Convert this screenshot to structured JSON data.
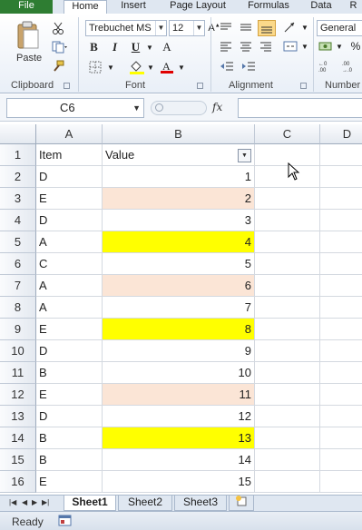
{
  "ribbon": {
    "tabs": [
      "File",
      "Home",
      "Insert",
      "Page Layout",
      "Formulas",
      "Data",
      "R"
    ],
    "active_tab": "Home",
    "groups": {
      "clipboard": "Clipboard",
      "font": "Font",
      "alignment": "Alignment",
      "number": "Number"
    },
    "clipboard": {
      "paste_label": "Paste"
    },
    "font": {
      "name": "Trebuchet MS",
      "size": "12",
      "bold": "B",
      "italic": "I",
      "underline": "U"
    },
    "number": {
      "format": "General",
      "percent": "%"
    },
    "colors": {
      "file_tab": "#2e7d32",
      "highlight_yellow": "#ffff00",
      "highlight_peach": "#fbe5d6",
      "font_color_bar": "#e00000",
      "fill_color_bar": "#ffff00"
    }
  },
  "formula_bar": {
    "name_box": "C6",
    "fx_label": "fx",
    "formula": ""
  },
  "grid": {
    "columns": [
      "A",
      "B",
      "C",
      "D"
    ],
    "header_row": {
      "row": "1",
      "a": "Item",
      "b": "Value"
    },
    "rows": [
      {
        "row": "2",
        "item": "D",
        "value": "1",
        "fill": "none"
      },
      {
        "row": "3",
        "item": "E",
        "value": "2",
        "fill": "peach"
      },
      {
        "row": "4",
        "item": "D",
        "value": "3",
        "fill": "none"
      },
      {
        "row": "5",
        "item": "A",
        "value": "4",
        "fill": "yellow"
      },
      {
        "row": "6",
        "item": "C",
        "value": "5",
        "fill": "none"
      },
      {
        "row": "7",
        "item": "A",
        "value": "6",
        "fill": "peach"
      },
      {
        "row": "8",
        "item": "A",
        "value": "7",
        "fill": "none"
      },
      {
        "row": "9",
        "item": "E",
        "value": "8",
        "fill": "yellow"
      },
      {
        "row": "10",
        "item": "D",
        "value": "9",
        "fill": "none"
      },
      {
        "row": "11",
        "item": "B",
        "value": "10",
        "fill": "none"
      },
      {
        "row": "12",
        "item": "E",
        "value": "11",
        "fill": "peach"
      },
      {
        "row": "13",
        "item": "D",
        "value": "12",
        "fill": "none"
      },
      {
        "row": "14",
        "item": "B",
        "value": "13",
        "fill": "yellow"
      },
      {
        "row": "15",
        "item": "B",
        "value": "14",
        "fill": "none"
      },
      {
        "row": "16",
        "item": "E",
        "value": "15",
        "fill": "none"
      }
    ]
  },
  "sheets": {
    "tabs": [
      "Sheet1",
      "Sheet2",
      "Sheet3"
    ],
    "active": "Sheet1"
  },
  "status": {
    "text": "Ready"
  }
}
